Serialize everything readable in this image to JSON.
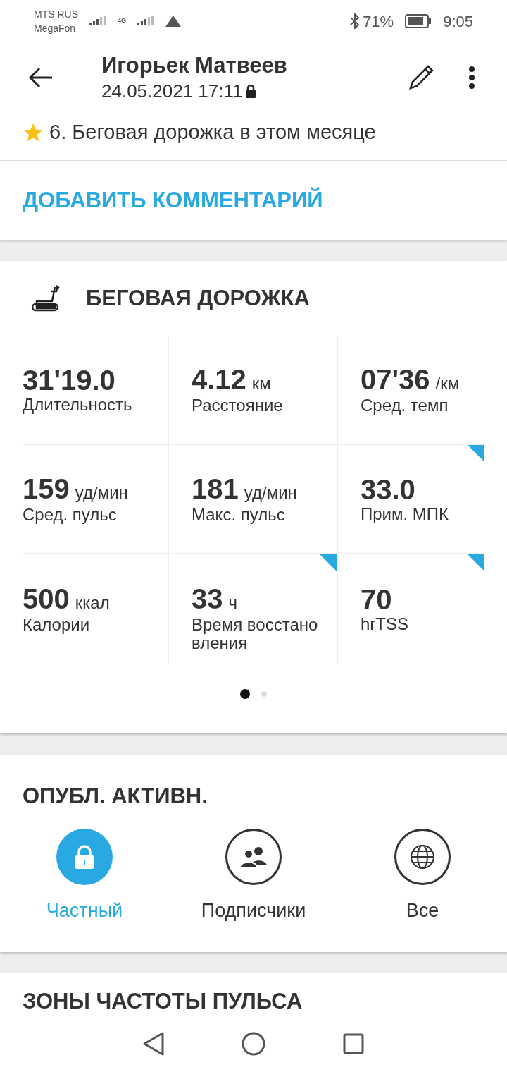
{
  "status_bar": {
    "carrier_1": "MTS RUS",
    "carrier_2": "MegaFon",
    "network": "4G",
    "battery": "71%",
    "time": "9:05"
  },
  "header": {
    "title": "Игорьек Матвеев",
    "datetime": "24.05.2021 17:11",
    "achievement": "6. Беговая дорожка в этом месяце"
  },
  "comment_button": "ДОБАВИТЬ КОММЕНТАРИЙ",
  "activity": {
    "title": "БЕГОВАЯ ДОРОЖКА",
    "stats": [
      {
        "value": "31'19.0",
        "label": "Длительность",
        "flagged": false
      },
      {
        "value": "4.12",
        "unit": "км",
        "label": "Расстояние",
        "flagged": false
      },
      {
        "value": "07'36",
        "unit": "/км",
        "label": "Сред. темп",
        "flagged": false
      },
      {
        "value": "159",
        "unit": "уд/мин",
        "label": "Сред. пульс",
        "flagged": false
      },
      {
        "value": "181",
        "unit": "уд/мин",
        "label": "Макс. пульс",
        "flagged": false
      },
      {
        "value": "33.0",
        "label": "Прим. МПК",
        "flagged": true
      },
      {
        "value": "500",
        "unit": "ккал",
        "label": "Калории",
        "flagged": false
      },
      {
        "value": "33",
        "unit": "ч",
        "label": "Время восстано\nвления",
        "flagged": true
      },
      {
        "value": "70",
        "label": "hrTSS",
        "flagged": true
      }
    ],
    "pages": [
      {
        "selected": true
      },
      {
        "selected": false
      }
    ]
  },
  "privacy": {
    "title": "ОПУБЛ. АКТИВН.",
    "options": [
      {
        "kind": "lock",
        "label": "Частный",
        "selected": true
      },
      {
        "kind": "people",
        "label": "Подписчики",
        "selected": false
      },
      {
        "kind": "globe",
        "label": "Все",
        "selected": false
      }
    ]
  },
  "next_section": {
    "title": "ЗОНЫ ЧАСТОТЫ ПУЛЬСА"
  }
}
